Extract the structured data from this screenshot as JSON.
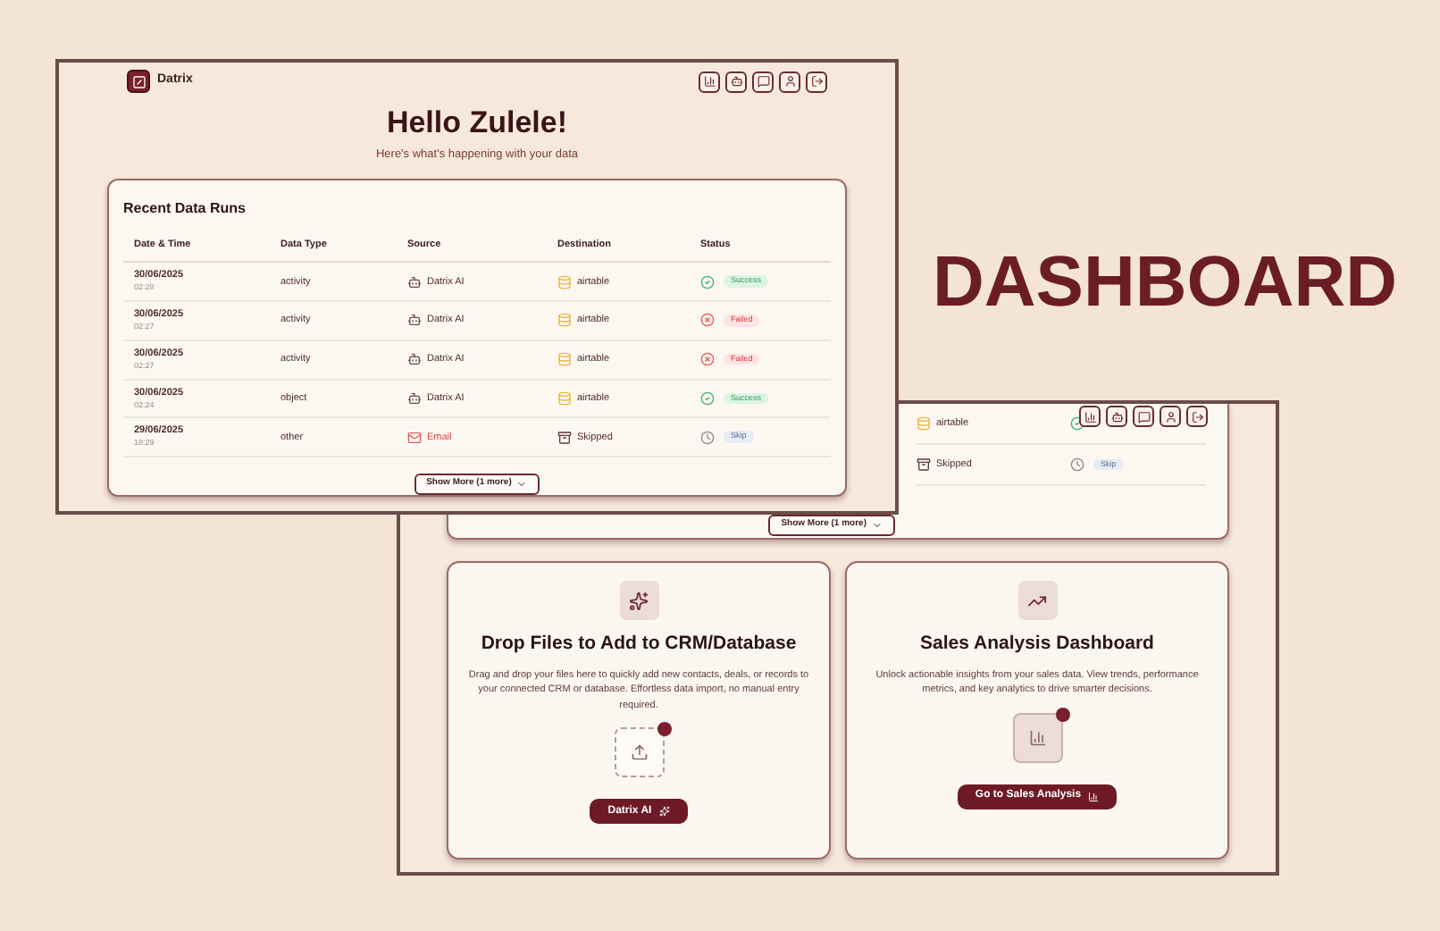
{
  "headline": "DASHBOARD",
  "main_window": {
    "brand": "Datrix",
    "greeting": "Hello Zulele!",
    "subtitle": "Here's what's happening with your data",
    "runs": {
      "title": "Recent Data Runs",
      "columns": [
        "Date & Time",
        "Data Type",
        "Source",
        "Destination",
        "Status"
      ],
      "rows": [
        {
          "date": "30/06/2025",
          "time": "02:28",
          "data_type": "activity",
          "source": {
            "kind": "ai",
            "label": "Datrix AI"
          },
          "destination": {
            "kind": "airtable",
            "label": "airtable"
          },
          "status": {
            "kind": "success",
            "label": "Success"
          }
        },
        {
          "date": "30/06/2025",
          "time": "02:27",
          "data_type": "activity",
          "source": {
            "kind": "ai",
            "label": "Datrix AI"
          },
          "destination": {
            "kind": "airtable",
            "label": "airtable"
          },
          "status": {
            "kind": "failed",
            "label": "Failed"
          }
        },
        {
          "date": "30/06/2025",
          "time": "02:27",
          "data_type": "activity",
          "source": {
            "kind": "ai",
            "label": "Datrix AI"
          },
          "destination": {
            "kind": "airtable",
            "label": "airtable"
          },
          "status": {
            "kind": "failed",
            "label": "Failed"
          }
        },
        {
          "date": "30/06/2025",
          "time": "02:24",
          "data_type": "object",
          "source": {
            "kind": "ai",
            "label": "Datrix AI"
          },
          "destination": {
            "kind": "airtable",
            "label": "airtable"
          },
          "status": {
            "kind": "success",
            "label": "Success"
          }
        },
        {
          "date": "29/06/2025",
          "time": "18:29",
          "data_type": "other",
          "source": {
            "kind": "email",
            "label": "Email"
          },
          "destination": {
            "kind": "skipped",
            "label": "Skipped"
          },
          "status": {
            "kind": "skip",
            "label": "Skip"
          }
        }
      ],
      "show_more": "Show More (1 more)"
    }
  },
  "second_window": {
    "rows": [
      {
        "destination": {
          "kind": "airtable",
          "label": "airtable"
        },
        "status": {
          "kind": "success"
        }
      },
      {
        "destination": {
          "kind": "skipped",
          "label": "Skipped"
        },
        "status": {
          "kind": "skip",
          "label": "Skip"
        }
      }
    ],
    "show_more": "Show More (1 more)",
    "cards": [
      {
        "kind": "upload",
        "title": "Drop Files to Add to CRM/Database",
        "description": "Drag and drop your files here to quickly add new contacts, deals, or records to your connected CRM or database. Effortless data import, no manual entry required.",
        "button": "Datrix AI"
      },
      {
        "kind": "sales",
        "title": "Sales Analysis Dashboard",
        "description": "Unlock actionable insights from your sales data. View trends, performance metrics, and key analytics to drive smarter decisions.",
        "button": "Go to Sales Analysis"
      }
    ]
  }
}
